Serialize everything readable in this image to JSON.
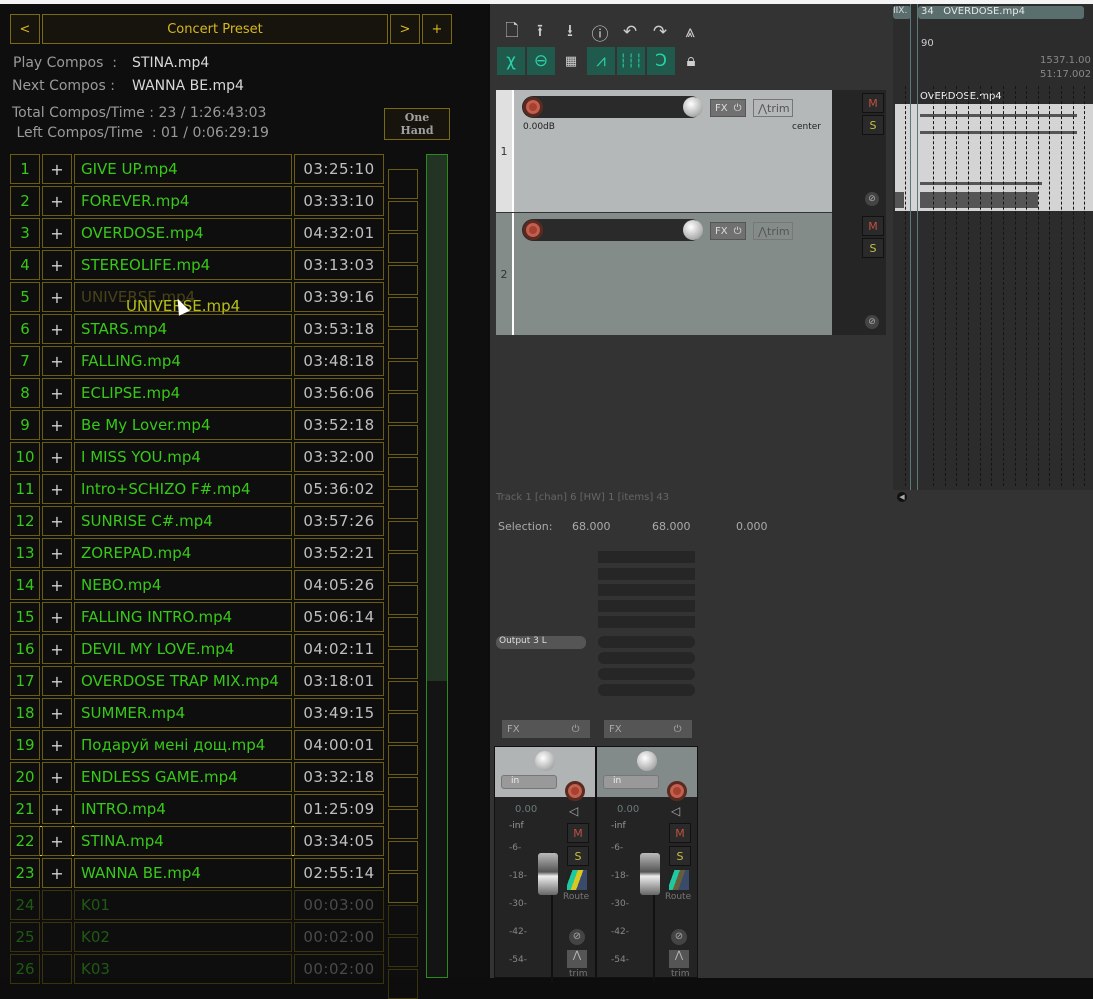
{
  "preset": {
    "prev": "<",
    "title": "Concert Preset",
    "next": ">",
    "add": "+"
  },
  "info": {
    "play_label": "Play Compos  :",
    "play_value": "STINA.mp4",
    "next_label": "Next Compos :",
    "next_value": "WANNA BE.mp4",
    "total_label": "Total Compos/Time : 23 / 1:26:43:03",
    "left_label": " Left Compos/Time  : 01 / 0:06:29:19"
  },
  "one_hand": {
    "line1": "One",
    "line2": "Hand"
  },
  "drag_ghost": "UNIVERSE.mp4",
  "playlist": [
    {
      "n": "1",
      "name": "GIVE UP.mp4",
      "time": "03:25:10"
    },
    {
      "n": "2",
      "name": "FOREVER.mp4",
      "time": "03:33:10"
    },
    {
      "n": "3",
      "name": "OVERDOSE.mp4",
      "time": "04:32:01"
    },
    {
      "n": "4",
      "name": "STEREOLIFE.mp4",
      "time": "03:13:03"
    },
    {
      "n": "5",
      "name": "UNIVERSE.mp4",
      "time": "03:39:16"
    },
    {
      "n": "6",
      "name": "STARS.mp4",
      "time": "03:53:18"
    },
    {
      "n": "7",
      "name": "FALLING.mp4",
      "time": "03:48:18"
    },
    {
      "n": "8",
      "name": "ECLIPSE.mp4",
      "time": "03:56:06"
    },
    {
      "n": "9",
      "name": "Be My Lover.mp4",
      "time": "03:52:18"
    },
    {
      "n": "10",
      "name": "I MISS YOU.mp4",
      "time": "03:32:00"
    },
    {
      "n": "11",
      "name": "Intro+SCHIZO F#.mp4",
      "time": "05:36:02"
    },
    {
      "n": "12",
      "name": "SUNRISE C#.mp4",
      "time": "03:57:26"
    },
    {
      "n": "13",
      "name": "ZOREPAD.mp4",
      "time": "03:52:21"
    },
    {
      "n": "14",
      "name": "NEBO.mp4",
      "time": "04:05:26"
    },
    {
      "n": "15",
      "name": "FALLING INTRO.mp4",
      "time": "05:06:14"
    },
    {
      "n": "16",
      "name": "DEVIL MY LOVE.mp4",
      "time": "04:02:11"
    },
    {
      "n": "17",
      "name": "OVERDOSE TRAP MIX.mp4",
      "time": "03:18:01"
    },
    {
      "n": "18",
      "name": "SUMMER.mp4",
      "time": "03:49:15"
    },
    {
      "n": "19",
      "name": "Подаруй мені дощ.mp4",
      "time": "04:00:01"
    },
    {
      "n": "20",
      "name": "ENDLESS GAME.mp4",
      "time": "03:32:18"
    },
    {
      "n": "21",
      "name": "INTRO.mp4",
      "time": "01:25:09"
    },
    {
      "n": "22",
      "name": "STINA.mp4",
      "time": "03:34:05",
      "selected": true
    },
    {
      "n": "23",
      "name": "WANNA BE.mp4",
      "time": "02:55:14"
    },
    {
      "n": "24",
      "name": "K01",
      "time": "00:03:00",
      "dim": true
    },
    {
      "n": "25",
      "name": "K02",
      "time": "00:02:00",
      "dim": true
    },
    {
      "n": "26",
      "name": "K03",
      "time": "00:02:00",
      "dim": true
    }
  ],
  "scroll_fraction": 0.64,
  "tracks": [
    {
      "num": "1",
      "volume": "0.00dB",
      "pan": "center",
      "fx": "FX",
      "trim": "trim",
      "mute": "M",
      "solo": "S"
    },
    {
      "num": "2",
      "fx": "FX",
      "trim": "trim",
      "mute": "M",
      "solo": "S"
    }
  ],
  "timeline": {
    "region_prev": "IIX.",
    "region": "34   OVERDOSE.mp4",
    "marker": "90",
    "pos1": "1537.1.00",
    "pos2": "51:17.002",
    "item": "OVERDOSE.mp4"
  },
  "status": "Track 1 [chan] 6 [HW] 1 [items] 43",
  "selection": {
    "label": "Selection:",
    "start": "68.000",
    "end": "68.000",
    "length": "0.000"
  },
  "output": "Output 3 L",
  "mixer": [
    {
      "fx": "FX",
      "input": "in",
      "vol": "0.00",
      "inf": "-inf",
      "mute": "M",
      "solo": "S",
      "route": "Route",
      "trim": "trim"
    },
    {
      "fx": "FX",
      "input": "in",
      "vol": "0.00",
      "inf": "-inf",
      "mute": "M",
      "solo": "S",
      "route": "Route",
      "trim": "trim"
    }
  ],
  "scale": [
    "-6-",
    "-18-",
    "-30-",
    "-42-",
    "-54-"
  ],
  "colors": {
    "accent_green": "#38c818",
    "border_gold": "#6b5d10",
    "title_gold": "#d8b820",
    "teal": "#28d0a8"
  }
}
